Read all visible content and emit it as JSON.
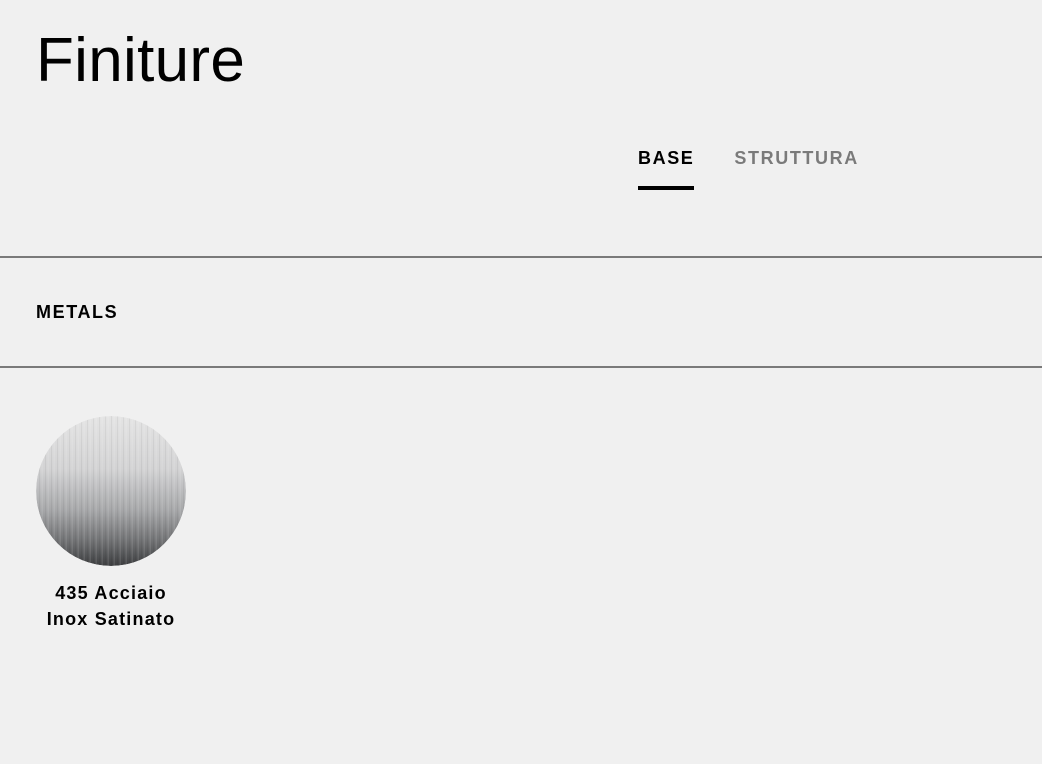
{
  "page": {
    "title": "Finiture"
  },
  "tabs": [
    {
      "label": "BASE",
      "active": true
    },
    {
      "label": "STRUTTURA",
      "active": false
    }
  ],
  "section": {
    "label": "METALS"
  },
  "finishes": [
    {
      "line1": "435 Acciaio",
      "line2": "Inox Satinato",
      "swatch_top_color": "#e4e4e4",
      "swatch_bottom_color": "#3d3e40"
    }
  ],
  "colors": {
    "background": "#f0f0f0",
    "text": "#000000",
    "inactive_tab": "#7a7a7a",
    "divider": "#7a7a7a"
  }
}
